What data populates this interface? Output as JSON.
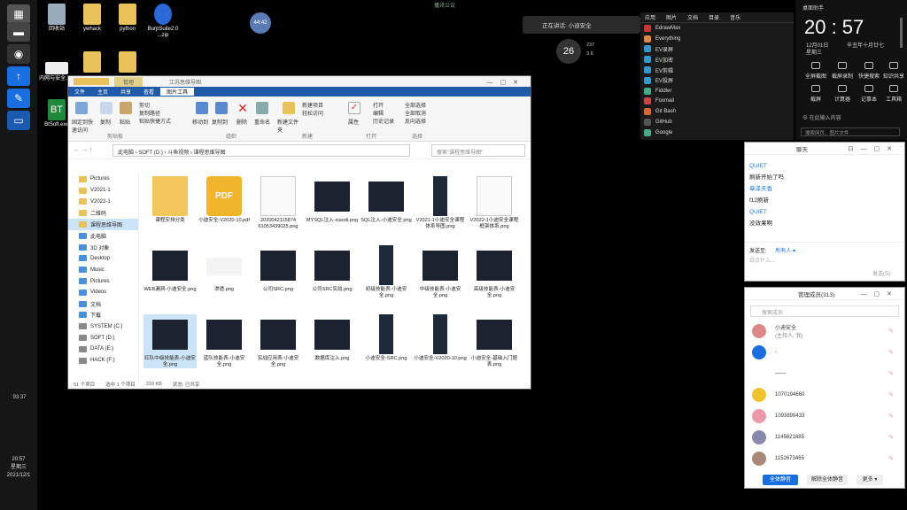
{
  "desktop": {
    "icons": [
      {
        "label": "回收站",
        "color": "#9ab"
      },
      {
        "label": "ywhack",
        "color": "#e8c25a"
      },
      {
        "label": "python",
        "color": "#e8c25a"
      },
      {
        "label": "BurpSuite2.0 ...zip",
        "color": "#2a6ad8"
      },
      {
        "label": "内网与安全.jpg",
        "color": "#eee"
      },
      {
        "label": "",
        "color": "#e8c25a"
      },
      {
        "label": "",
        "color": "#e8c25a"
      },
      {
        "label": "BtSoft.exe",
        "color": "#1e8a3a"
      }
    ],
    "circle_label": "44:42"
  },
  "taskbar": {
    "status": "93 37",
    "clock_time": "20:57",
    "clock_day": "星期三",
    "clock_date": "2021/12/1"
  },
  "top_center": {
    "text": "播讯公议",
    "ime": "正在讲话: 小迪安全",
    "speed": "26",
    "speed_up": "237",
    "speed_down": "3.6"
  },
  "explorer": {
    "title": "江苏思维导图",
    "context_tab": "管理",
    "tabs": [
      "文件",
      "主页",
      "共享",
      "查看",
      "图片工具"
    ],
    "ribbon": {
      "pin": "固定到快速访问",
      "copy": "复制",
      "paste": "粘贴",
      "copy_path": "复制路径",
      "paste_shortcut": "粘贴快捷方式",
      "cut": "剪切",
      "move_to": "移动到",
      "copy_to": "复制到",
      "delete": "删除",
      "rename": "重命名",
      "new_folder": "新建文件夹",
      "new_item": "新建项目",
      "easy_access": "轻松访问",
      "properties": "属性",
      "open": "打开",
      "edit": "编辑",
      "history": "历史记录",
      "select_all": "全部选择",
      "select_none": "全部取消",
      "invert": "反向选择",
      "grp_clipboard": "剪贴板",
      "grp_organize": "组织",
      "grp_new": "新建",
      "grp_open": "打开",
      "grp_select": "选择"
    },
    "address": "此电脑 › SOFT (D:) › 斗鱼视频 › 课程思维导图",
    "search_placeholder": "搜索\"课程思维导图\"",
    "nav": [
      {
        "label": "Pictures",
        "color": "#e8c25a"
      },
      {
        "label": "V2021-1",
        "color": "#e8c25a"
      },
      {
        "label": "V2022-1",
        "color": "#e8c25a"
      },
      {
        "label": "二维码",
        "color": "#e8c25a"
      },
      {
        "label": "课程思维导图",
        "color": "#e8c25a"
      },
      {
        "label": "此电脑",
        "color": "#4a90d9"
      },
      {
        "label": "3D 对象",
        "color": "#4a90d9"
      },
      {
        "label": "Desktop",
        "color": "#4a90d9"
      },
      {
        "label": "Music",
        "color": "#4a90d9"
      },
      {
        "label": "Pictures",
        "color": "#4a90d9"
      },
      {
        "label": "Videos",
        "color": "#4a90d9"
      },
      {
        "label": "文档",
        "color": "#4a90d9"
      },
      {
        "label": "下载",
        "color": "#4a90d9"
      },
      {
        "label": "SYSTEM (C:)",
        "color": "#888"
      },
      {
        "label": "SOFT (D:)",
        "color": "#888"
      },
      {
        "label": "DATA (E:)",
        "color": "#888"
      },
      {
        "label": "HACK (F:)",
        "color": "#888"
      }
    ],
    "files": [
      {
        "name": "课程安排分类",
        "kind": "folder"
      },
      {
        "name": "小迪安全-V2020-10.pdf",
        "kind": "pdf"
      },
      {
        "name": "2020042115874 61053439025.png",
        "kind": "doc"
      },
      {
        "name": "MYSQL注入-xiaodi.png",
        "kind": "mind"
      },
      {
        "name": "SQL注入-小迪安全.png",
        "kind": "mind"
      },
      {
        "name": "V2021-1小迪安全课程体系导图.png",
        "kind": "tall"
      },
      {
        "name": "V2022-1小迪安全课程框架体系.png",
        "kind": "doc"
      },
      {
        "name": "WEB漏洞-小迪安全.png",
        "kind": "mind"
      },
      {
        "name": "渗透.png",
        "kind": "light"
      },
      {
        "name": "公司SRC.png",
        "kind": "mind"
      },
      {
        "name": "公司SRC实战.png",
        "kind": "mind"
      },
      {
        "name": "初级技能表-小迪安全.png",
        "kind": "tall"
      },
      {
        "name": "中级技能表-小迪安全.png",
        "kind": "mind"
      },
      {
        "name": "高级技能表-小迪安全.png",
        "kind": "mind"
      },
      {
        "name": "红队中级技能表-小迪安全.png",
        "kind": "mind"
      },
      {
        "name": "蓝队技能表-小迪安全.png",
        "kind": "mind"
      },
      {
        "name": "实战应用表-小迪安全.png",
        "kind": "mind"
      },
      {
        "name": "数据库注入.png",
        "kind": "mind"
      },
      {
        "name": "小迪安全-SRC.png",
        "kind": "tall"
      },
      {
        "name": "小迪安全-V2020-10.png",
        "kind": "tall"
      },
      {
        "name": "小迪安全-基础入门题表.png",
        "kind": "mind"
      }
    ],
    "status": {
      "count": "51 个项目",
      "selected": "选中 1 个项目",
      "size": "319 KB",
      "state": "状态: 已共享"
    }
  },
  "apps": {
    "tabs": [
      "应用",
      "图片",
      "文档",
      "目录",
      "音乐"
    ],
    "items": [
      {
        "label": "EdrawMax",
        "color": "#c33"
      },
      {
        "label": "Everything",
        "color": "#d84"
      },
      {
        "label": "EV录屏",
        "color": "#39c"
      },
      {
        "label": "EV加密",
        "color": "#39c"
      },
      {
        "label": "EV剪辑",
        "color": "#39c"
      },
      {
        "label": "EV投屏",
        "color": "#39c"
      },
      {
        "label": "Fiddler",
        "color": "#4a8"
      },
      {
        "label": "Foxmail",
        "color": "#c44"
      },
      {
        "label": "Git Bash",
        "color": "#d63"
      },
      {
        "label": "GitHub",
        "color": "#555"
      },
      {
        "label": "Google",
        "color": "#4a8"
      }
    ]
  },
  "clock_panel": {
    "title": "桌面助手",
    "time": "20 : 57",
    "date": "12月01日",
    "weekday": "星期三",
    "lunar": "辛丑年十月廿七",
    "quick": [
      "全屏截图",
      "截屏录制",
      "快捷搜索",
      "知识共享",
      "截屏",
      "计算器",
      "记事本",
      "工具箱"
    ],
    "add_label": "在此输入内容",
    "search_placeholder": "搜索网页、图片文件"
  },
  "chat": {
    "title": "聊天",
    "lines": [
      {
        "text": "QUIET",
        "color": "#1a7ad8"
      },
      {
        "text": "刷新开始了吗",
        "color": "#222"
      },
      {
        "text": "章泽天香",
        "color": "#1a7ad8"
      },
      {
        "text": "f12刷新",
        "color": "#222"
      },
      {
        "text": "QUIET",
        "color": "#1a7ad8"
      },
      {
        "text": "没效果啊",
        "color": "#222"
      }
    ],
    "send_to_label": "发送至:",
    "send_to_value": "所有人 ▾",
    "input_placeholder": "说点什么...",
    "send_label": "发送(S)"
  },
  "members": {
    "title": "管理成员(313)",
    "search_placeholder": "搜索成员",
    "list": [
      {
        "name": "小迪安全",
        "sub": "(主持人, 我)",
        "color": "#d88"
      },
      {
        "name": "-",
        "sub": "",
        "color": "#1a6fe0"
      },
      {
        "name": "——",
        "sub": "",
        "color": "#fff"
      },
      {
        "name": "1070194660",
        "sub": "",
        "color": "#f2c12e"
      },
      {
        "name": "1093899433",
        "sub": "",
        "color": "#e9a"
      },
      {
        "name": "1145821685",
        "sub": "",
        "color": "#88a"
      },
      {
        "name": "1152673465",
        "sub": "",
        "color": "#a87"
      }
    ],
    "mute_all": "全体静音",
    "unmute_all": "解除全体静音",
    "more": "更多 ▾"
  }
}
